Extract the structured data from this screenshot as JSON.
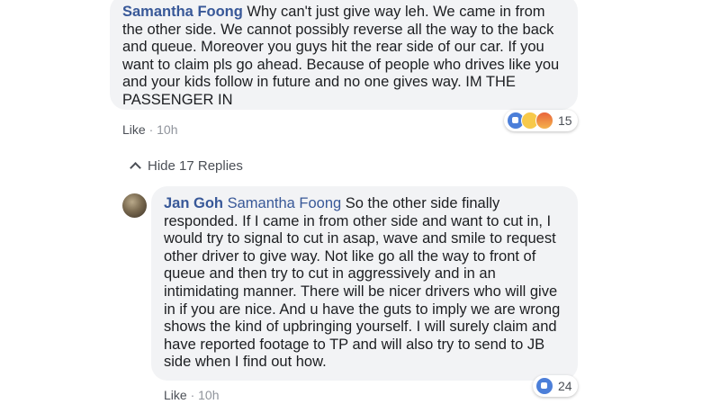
{
  "comment1": {
    "author": "Samantha Foong",
    "text": " Why can't just give way leh. We came in from the other side. We cannot possibly reverse all the way to the back and queue. Moreover you guys hit the rear side of our car. If you want to claim pls go ahead. Because of people who drives like you and your kids follow in future and no one gives way. IM THE PASSENGER IN",
    "like_label": "Like",
    "separator": " · ",
    "time": "10h",
    "reaction_count": "15",
    "reactions": [
      "like-icon",
      "haha-icon",
      "angry-icon"
    ]
  },
  "replies_toggle": {
    "label": "Hide 17 Replies"
  },
  "reply1": {
    "author": "Jan Goh",
    "mention": "Samantha Foong",
    "text": " So the other side finally responded. If I came in from other side and want to cut in, I would try to signal to cut in asap, wave and smile to request other driver to give way. Not like go all the way to front of queue and then try to cut in aggressively and in an intimidating manner. There will be nicer drivers who will give in if you are nice. And u have the guts to imply we are wrong shows the kind of upbringing yourself. I will surely claim and have reported footage to TP and will also try to send to JB side when I find out how.",
    "like_label": "Like",
    "separator": " · ",
    "time": "10h",
    "reaction_count": "24",
    "reactions": [
      "like-icon"
    ]
  }
}
